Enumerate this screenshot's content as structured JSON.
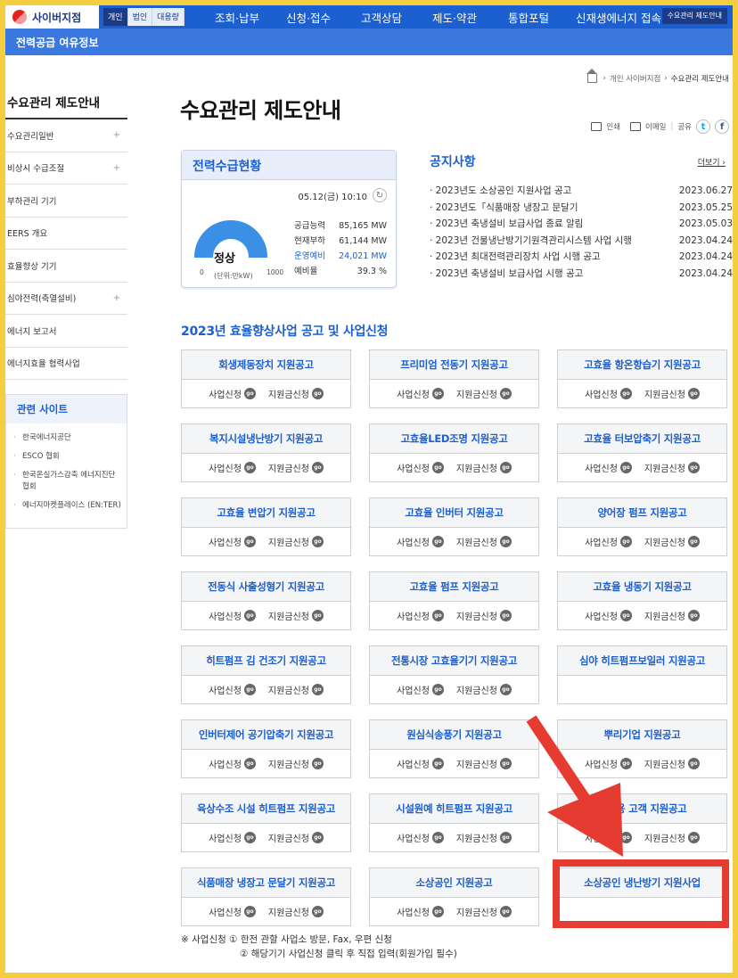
{
  "topbar": {
    "logo": "사이버지점",
    "segments": [
      "개인",
      "법인",
      "대용량"
    ],
    "menu": [
      "조회·납부",
      "신청·접수",
      "고객상담",
      "제도·약관",
      "통합포털",
      "신재생에너지 접속"
    ],
    "corner": "수요관리 제도안내"
  },
  "subbar": {
    "label": "전력공급 여유정보"
  },
  "breadcrumb": [
    "개인 사이버지점",
    "수요관리 제도안내"
  ],
  "page_title": "수요관리 제도안내",
  "share": {
    "print": "인쇄",
    "email": "이메일",
    "share": "공유",
    "twitter": "t",
    "facebook": "f"
  },
  "sidebar": {
    "title": "수요관리 제도안내",
    "items": [
      {
        "label": "수요관리일반",
        "plus": "+"
      },
      {
        "label": "비상시 수급조절",
        "plus": "+"
      },
      {
        "label": "부하관리 기기",
        "plus": ""
      },
      {
        "label": "EERS 개요",
        "plus": ""
      },
      {
        "label": "효율향상 기기",
        "plus": ""
      },
      {
        "label": "심야전력(축열설비)",
        "plus": "+"
      },
      {
        "label": "에너지 보고서",
        "plus": ""
      },
      {
        "label": "에너지효율 협력사업",
        "plus": ""
      }
    ],
    "related_title": "관련 사이트",
    "related": [
      "한국에너지공단",
      "ESCO 협회",
      "한국온실가스감축 에너지진단협회",
      "에너지마켓플레이스 (EN:TER)"
    ]
  },
  "power": {
    "title": "전력수급현황",
    "datetime": "05.12(금) 10:10",
    "refresh_icon": "↻",
    "state": "정상",
    "unit": "(단위:만kW)",
    "gauge_min": "0",
    "gauge_max": "1000",
    "stats": [
      {
        "label": "공급능력",
        "value": "85,165 MW"
      },
      {
        "label": "현재부하",
        "value": "61,144 MW"
      },
      {
        "label": "운영예비",
        "value": "24,021 MW"
      },
      {
        "label": "예비율",
        "value": "39.3 %"
      }
    ],
    "gauge_color": "#3b8fe4"
  },
  "notice": {
    "title": "공지사항",
    "more": "더보기 ›",
    "items": [
      {
        "title": "· 2023년도 소상공인 지원사업 공고",
        "date": "2023.06.27"
      },
      {
        "title": "· 2023년도「식품매장 냉장고 문달기",
        "date": "2023.05.25"
      },
      {
        "title": "· 2023년 축냉설비 보급사업 종료 알림",
        "date": "2023.05.03"
      },
      {
        "title": "· 2023년 건물냉난방기기원격관리시스템 사업 시행",
        "date": "2023.04.24"
      },
      {
        "title": "· 2023년 최대전력관리장치 사업 시행 공고",
        "date": "2023.04.24"
      },
      {
        "title": "· 2023년 축냉설비 보급사업 시행 공고",
        "date": "2023.04.24"
      }
    ]
  },
  "programs": {
    "title": "2023년 효율향상사업 공고 및 사업신청",
    "apply_label": "사업신청",
    "subsidy_label": "지원금신청",
    "go_badge": "go",
    "cards": [
      {
        "title": "회생제동장치 지원공고",
        "links": true
      },
      {
        "title": "프리미엄 전동기 지원공고",
        "links": true
      },
      {
        "title": "고효율 항온항습기 지원공고",
        "links": true
      },
      {
        "title": "복지시설냉난방기 지원공고",
        "links": true
      },
      {
        "title": "고효율LED조명 지원공고",
        "links": true
      },
      {
        "title": "고효율 터보압축기 지원공고",
        "links": true
      },
      {
        "title": "고효율 변압기 지원공고",
        "links": true
      },
      {
        "title": "고효율 인버터 지원공고",
        "links": true
      },
      {
        "title": "양어장 펌프 지원공고",
        "links": true
      },
      {
        "title": "전동식 사출성형기 지원공고",
        "links": true
      },
      {
        "title": "고효율 펌프 지원공고",
        "links": true
      },
      {
        "title": "고효율 냉동기 지원공고",
        "links": true
      },
      {
        "title": "히트펌프 김 건조기 지원공고",
        "links": true
      },
      {
        "title": "전통시장 고효율기기 지원공고",
        "links": true
      },
      {
        "title": "심야 히트펌프보일러 지원공고",
        "links": false
      },
      {
        "title": "인버터제어 공기압축기 지원공고",
        "links": true
      },
      {
        "title": "원심식송풍기 지원공고",
        "links": true
      },
      {
        "title": "뿌리기업 지원공고",
        "links": true
      },
      {
        "title": "육상수조 시설 히트펌프 지원공고",
        "links": true
      },
      {
        "title": "시설원예 히트펌프 지원공고",
        "links": true
      },
      {
        "title": "농사용 고객 지원공고",
        "links": true
      },
      {
        "title": "식품매장 냉장고 문달기 지원공고",
        "links": true
      },
      {
        "title": "소상공인 지원공고",
        "links": true
      },
      {
        "title": "소상공인 냉난방기 지원사업",
        "links": false
      }
    ]
  },
  "footnote": {
    "line1": "※ 사업신청   ① 한전 관할 사업소 방문, Fax, 우편 신청",
    "line2": "② 해당기기 사업신청 클릭 후 직접 입력(회원가입 필수)"
  },
  "colors": {
    "brand": "#1b5fd0",
    "highlight": "#e53b30",
    "frame": "#f4ce3e"
  }
}
